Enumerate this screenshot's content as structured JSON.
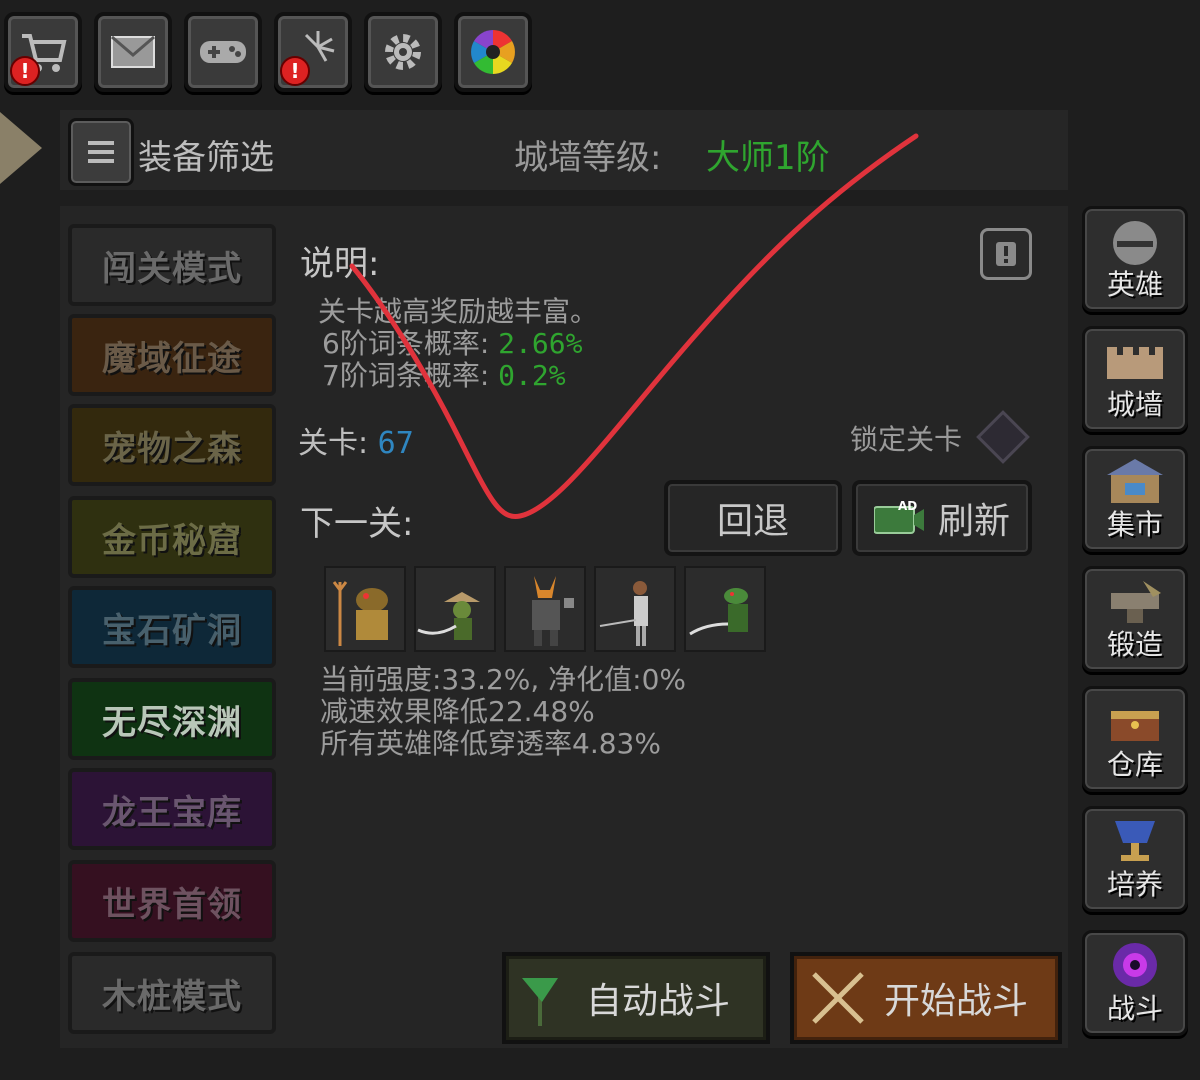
{
  "top_icons": [
    {
      "name": "shop-cart-icon",
      "alert": true
    },
    {
      "name": "mail-icon",
      "alert": false
    },
    {
      "name": "gamepad-icon",
      "alert": false
    },
    {
      "name": "fireworks-icon",
      "alert": true
    },
    {
      "name": "gear-icon",
      "alert": false
    },
    {
      "name": "color-wheel-icon",
      "alert": false
    }
  ],
  "alert_symbol": "!",
  "header": {
    "filter_label": "装备筛选",
    "wall_level_label": "城墙等级:",
    "wall_level_value": "大师1阶"
  },
  "modes": [
    {
      "label": "闯关模式",
      "color": "#2a2a2a",
      "text": "#6a6a6a"
    },
    {
      "label": "魔域征途",
      "color": "#3a2410",
      "text": "#6a5a48"
    },
    {
      "label": "宠物之森",
      "color": "#33290d",
      "text": "#6a6448"
    },
    {
      "label": "金币秘窟",
      "color": "#2f3010",
      "text": "#6c6c46"
    },
    {
      "label": "宝石矿洞",
      "color": "#0e2838",
      "text": "#48606c"
    },
    {
      "label": "无尽深渊",
      "color": "#0f3312",
      "text": "#b9c7b9"
    },
    {
      "label": "龙王宝库",
      "color": "#2c1336",
      "text": "#6a5670"
    },
    {
      "label": "世界首领",
      "color": "#351020",
      "text": "#6e5260"
    },
    {
      "label": "木桩模式",
      "color": "#2a2a2a",
      "text": "#6a6a6a"
    }
  ],
  "description": {
    "title": "说明:",
    "line1": "关卡越高奖励越丰富。",
    "line2_label": "6阶词条概率:",
    "line2_value": "2.66%",
    "line3_label": "7阶词条概率:",
    "line3_value": "0.2%"
  },
  "level": {
    "label": "关卡:",
    "value": "67",
    "lock_label": "锁定关卡"
  },
  "next": {
    "label": "下一关:",
    "back_button": "回退",
    "refresh_button": "刷新",
    "ad_tag": "AD"
  },
  "stats": {
    "line1": "当前强度:33.2%, 净化值:0%",
    "line2": "减速效果降低22.48%",
    "line3": "所有英雄降低穿透率4.83%"
  },
  "battle": {
    "auto": "自动战斗",
    "start": "开始战斗"
  },
  "side_menu": [
    {
      "label": "英雄",
      "icon": "helmet-icon"
    },
    {
      "label": "城墙",
      "icon": "wall-icon"
    },
    {
      "label": "集市",
      "icon": "market-icon"
    },
    {
      "label": "锻造",
      "icon": "anvil-icon"
    },
    {
      "label": "仓库",
      "icon": "treasure-chest-icon"
    },
    {
      "label": "培养",
      "icon": "chalice-icon"
    },
    {
      "label": "战斗",
      "icon": "portal-icon"
    }
  ],
  "annotation_color": "#e0333c"
}
